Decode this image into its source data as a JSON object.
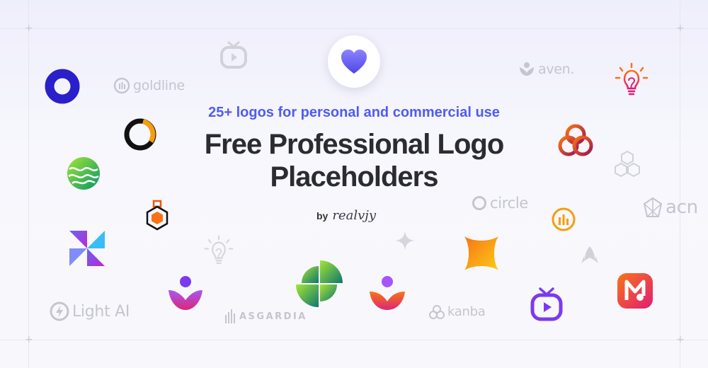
{
  "hero": {
    "subtitle": "25+ logos for personal and commercial use",
    "title_line1": "Free Professional Logo",
    "title_line2": "Placeholders",
    "by": "by",
    "signature": "realvjy"
  },
  "wordmarks": {
    "goldline": "goldline",
    "aven": "aven.",
    "circle": "circle",
    "acme": "acn",
    "lightai": "Light AI",
    "asgardia": "ASGARDIA",
    "kanba": "kanba"
  },
  "colors": {
    "accent": "#4f5cf0",
    "title": "#2b2b33",
    "muted_logo": "#c4c5cf",
    "navy": "#2a20c9",
    "orange": "#f59e0b"
  }
}
